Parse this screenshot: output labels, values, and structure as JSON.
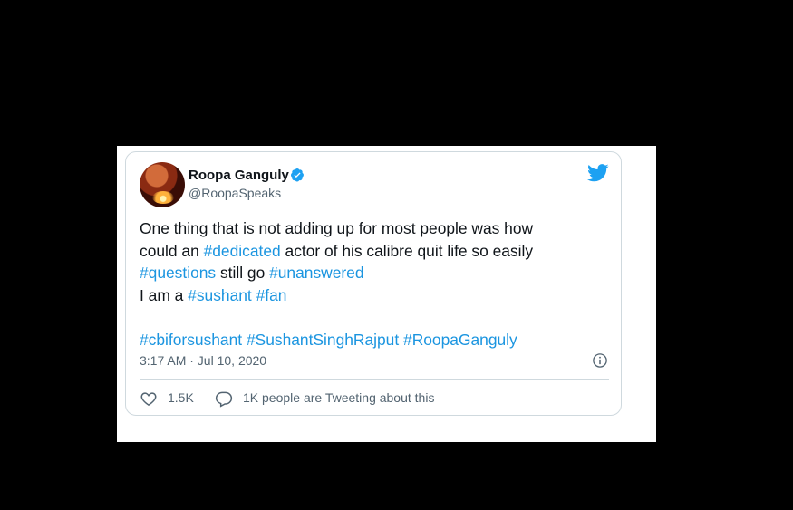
{
  "tweet": {
    "author_name": "Roopa Ganguly",
    "author_handle": "@RoopaSpeaks",
    "text": {
      "l1": "One thing that is not adding up for most people was how",
      "l2_pre": "could an ",
      "l2_tag": "#dedicated",
      "l2_post": " actor of his calibre quit life so easily",
      "l3_tag1": "#questions",
      "l3_mid": " still go ",
      "l3_tag2": "#unanswered",
      "l4_pre": "I am a ",
      "l4_tag1": "#sushant",
      "l4_tag2": "#fan",
      "h1": "#cbiforsushant",
      "h2": "#SushantSinghRajput",
      "h3": "#RoopaGanguly"
    },
    "timestamp": "3:17 AM · Jul 10, 2020",
    "likes": "1.5K",
    "replies_label": "1K people are Tweeting about this"
  },
  "icons": {
    "verified": "verified-badge-icon",
    "bird": "twitter-bird-icon",
    "info": "info-icon",
    "heart": "heart-icon",
    "reply": "reply-icon"
  },
  "colors": {
    "link": "#1b95e0",
    "text": "#0f1419",
    "muted": "#536471",
    "twitter_blue": "#1da1f2"
  }
}
